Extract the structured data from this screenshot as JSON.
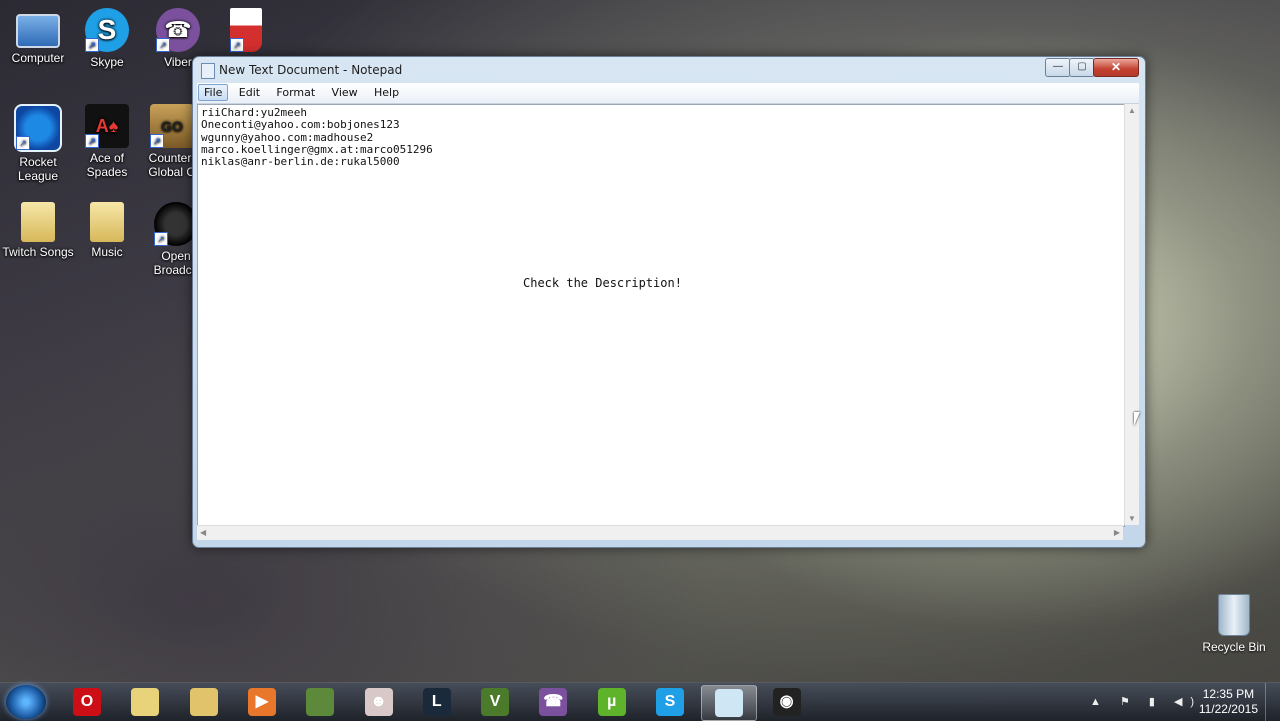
{
  "desktop": {
    "icons": [
      {
        "label": "Computer",
        "icon": "computer-icon"
      },
      {
        "label": "Skype",
        "icon": "skype-icon"
      },
      {
        "label": "Viber",
        "icon": "viber-icon"
      },
      {
        "label": "",
        "icon": "popcorn-time-icon"
      },
      {
        "label": "Rocket\nLeague",
        "icon": "rocket-league-icon"
      },
      {
        "label": "Ace of\nSpades",
        "icon": "ace-of-spades-icon"
      },
      {
        "label": "Counter-\nGlobal O",
        "icon": "counter-strike-icon"
      },
      {
        "label": "Twitch Songs",
        "icon": "folder-icon"
      },
      {
        "label": "Music",
        "icon": "folder-icon"
      },
      {
        "label": "Open\nBroadca",
        "icon": "obs-icon"
      }
    ],
    "recycle_bin": {
      "label": "Recycle Bin",
      "icon": "recycle-bin-icon"
    }
  },
  "notepad": {
    "title": "New Text Document - Notepad",
    "controls": {
      "minimize": "—",
      "maximize": "▢",
      "close": "✕"
    },
    "menu": [
      "File",
      "Edit",
      "Format",
      "View",
      "Help"
    ],
    "active_menu": "File",
    "lines": [
      "riiChard:yu2meeh",
      "Oneconti@yahoo.com:bobjones123",
      "wgunny@yahoo.com:madhouse2",
      "marco.koellinger@gmx.at:marco051296",
      "niklas@anr-berlin.de:rukal5000"
    ],
    "center_note": "Check the Description!"
  },
  "taskbar": {
    "buttons": [
      {
        "name": "opera-icon",
        "glyph": "O",
        "color": "#cc0f16"
      },
      {
        "name": "folder-icon",
        "glyph": "",
        "color": "#e8d27a"
      },
      {
        "name": "explorer-icon",
        "glyph": "",
        "color": "#e0c36a"
      },
      {
        "name": "media-player-icon",
        "glyph": "▶",
        "color": "#e8762b"
      },
      {
        "name": "minecraft-icon",
        "glyph": "",
        "color": "#5c8a3a"
      },
      {
        "name": "binding-of-isaac-icon",
        "glyph": "☻",
        "color": "#d9c8c8"
      },
      {
        "name": "league-of-legends-icon",
        "glyph": "L",
        "color": "#1a2a3a"
      },
      {
        "name": "gta-v-icon",
        "glyph": "V",
        "color": "#4a7a2a"
      },
      {
        "name": "viber-icon",
        "glyph": "☎",
        "color": "#7b519d"
      },
      {
        "name": "utorrent-icon",
        "glyph": "µ",
        "color": "#5fb32a"
      },
      {
        "name": "skype-icon",
        "glyph": "S",
        "color": "#1fa0e6"
      },
      {
        "name": "notepad-icon",
        "glyph": "",
        "color": "#cfe6f5"
      },
      {
        "name": "obs-icon",
        "glyph": "◉",
        "color": "#222222"
      }
    ],
    "tray": {
      "icons": "▲ ⚑ ▮ ◀)",
      "time": "12:35 PM",
      "date": "11/22/2015"
    }
  }
}
